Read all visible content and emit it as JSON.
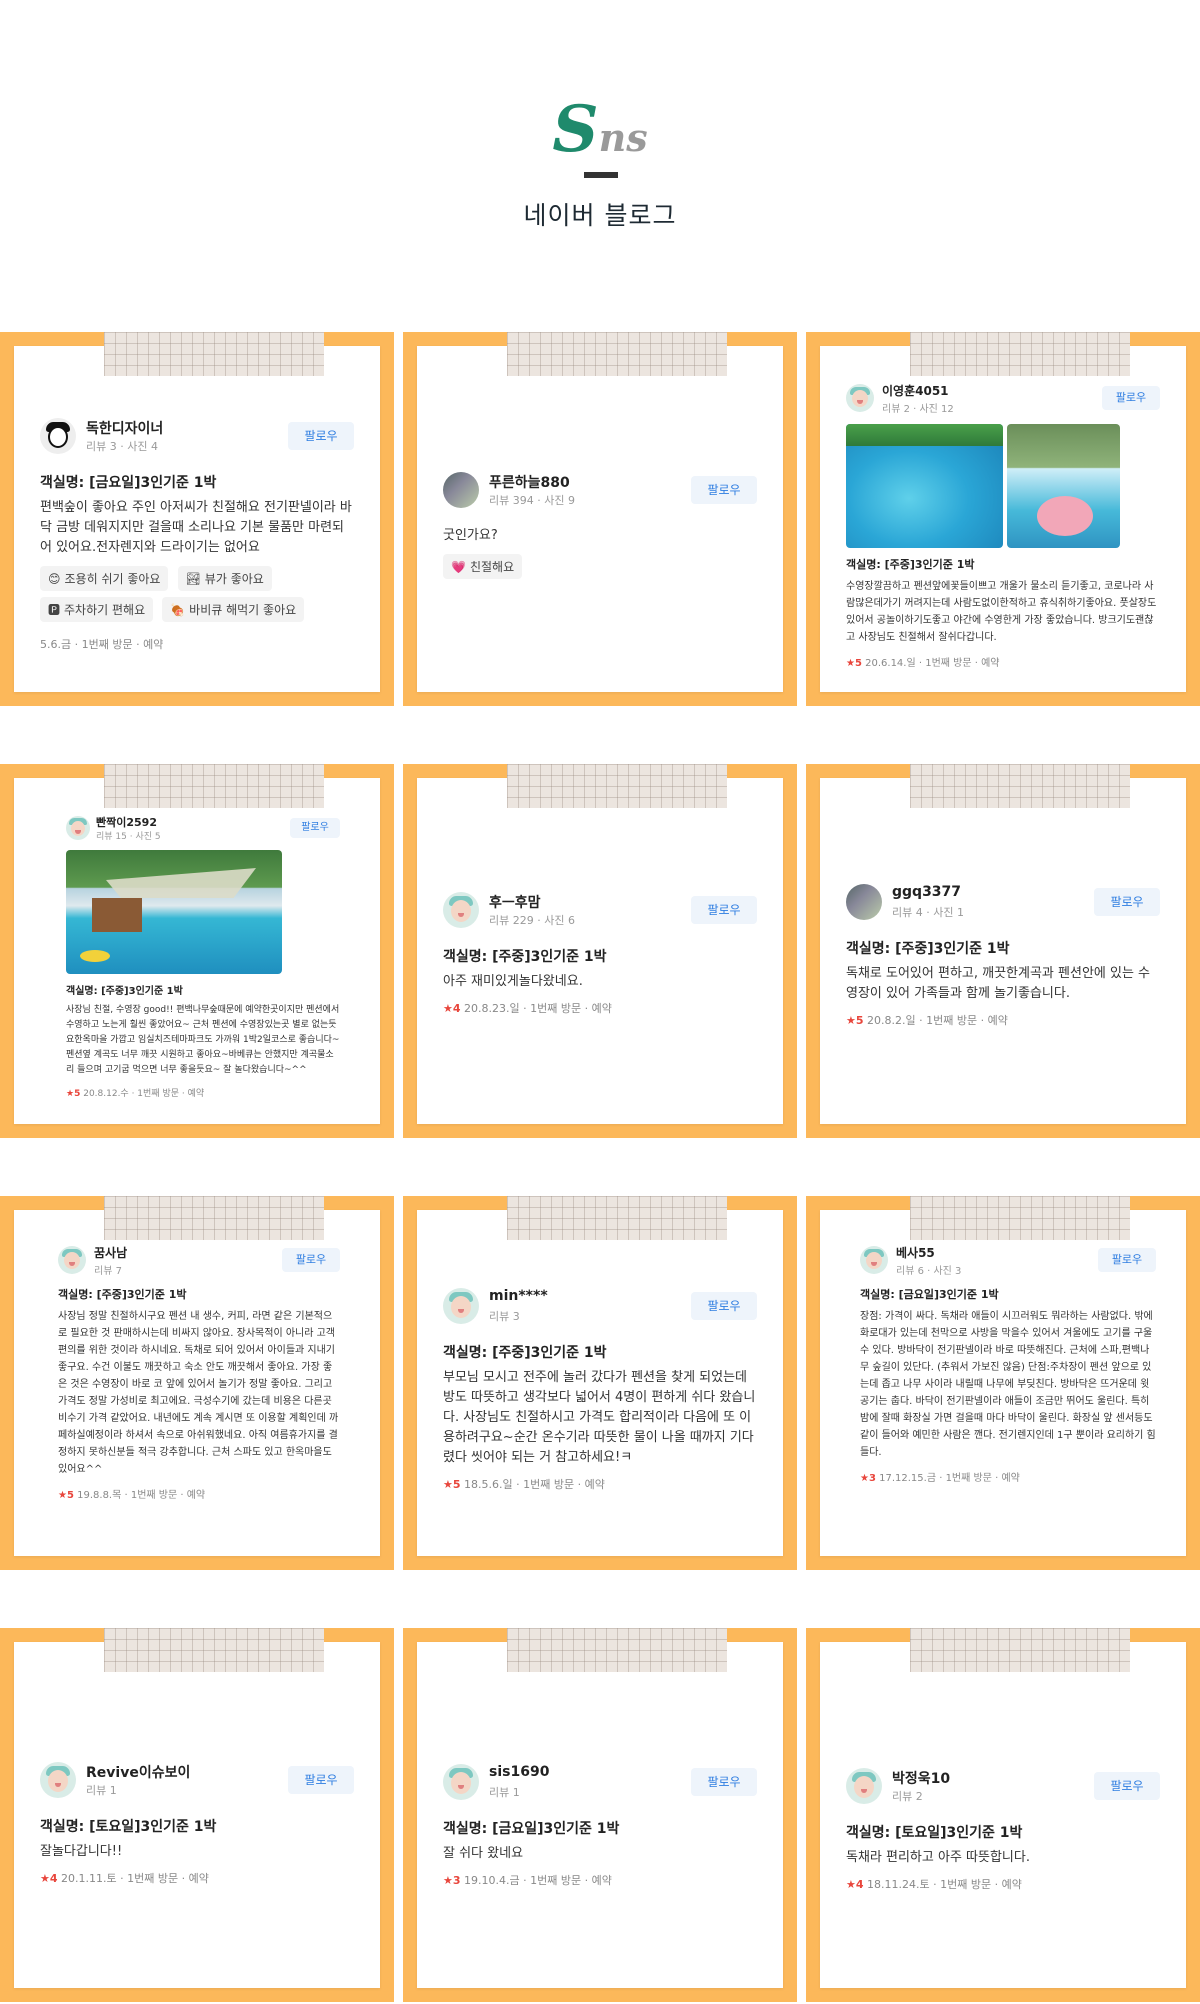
{
  "header": {
    "logo_cap": "S",
    "logo_rest": "ns",
    "title": "네이버 블로그"
  },
  "follow_label": "팔로우",
  "cards": [
    {
      "nick": "독한디자이너",
      "meta": "리뷰 3 · 사진 4",
      "room": "객실명: [금요일]3인기준 1박",
      "body": "편백숲이 좋아요 주인 아저씨가 친절해요 전기판넬이라 바닥 금방 데워지지만 걸을때 소리나요 기본 물품만 마련되어 있어요.전자렌지와 드라이기는 없어요",
      "tags": [
        {
          "icon": "😊",
          "label": "조용히 쉬기 좋아요"
        },
        {
          "icon": "🏞",
          "label": "뷰가 좋아요"
        },
        {
          "icon": "🅿",
          "label": "주차하기 편해요"
        },
        {
          "icon": "🍖",
          "label": "바비큐 해먹기 좋아요"
        }
      ],
      "foot": "5.6.금 · 1번째 방문 · 예약"
    },
    {
      "nick": "푸른하늘880",
      "meta": "리뷰 394 · 사진 9",
      "body": "굿인가요?",
      "tags": [
        {
          "icon": "💗",
          "label": "친절해요"
        }
      ]
    },
    {
      "nick": "이영훈4051",
      "meta": "리뷰 2 · 사진 12",
      "room": "객실명: [주중]3인기준 1박",
      "body": "수영장깔끔하고 펜션앞에꽃들이쁘고 개울가 물소리 듣기좋고, 코로나라 사람많은데가기 꺼려지는데 사람도없이한적하고 휴식취하기좋아요. 풋살장도있어서 공놀이하기도좋고 야간에 수영한게 가장 좋았습니다. 방크기도괜찮고 사장님도 친절해서 잘쉬다갑니다.",
      "star": "★5",
      "foot": "20.6.14.일 · 1번째 방문 · 예약"
    },
    {
      "nick": "빤짝이2592",
      "meta": "리뷰 15 · 사진 5",
      "room": "객실명: [주중]3인기준 1박",
      "body": "사장님 친절, 수영장 good!! 편백나무숲때문에 예약한곳이지만 펜션에서 수영하고 노는게 훨씬 좋았어요~ 근처 펜션에 수영장있는곳 별로 없는듯요한옥마을 가깝고 임실치즈테마파크도 가까워 1박2일코스로 좋습니다~ 펜션옆 계곡도 너무 깨끗 시원하고 좋아요~바베큐는 안했지만 계곡물소리 들으며 고기굽 먹으면 너무 좋을듯요~ 잘 놀다왔습니다~^^",
      "star": "★5",
      "foot": "20.8.12.수 · 1번째 방문 · 예약"
    },
    {
      "nick": "후ㅡ후맘",
      "meta": "리뷰 229 · 사진 6",
      "room": "객실명: [주중]3인기준 1박",
      "body": "아주 재미있게놀다왔네요.",
      "star": "★4",
      "foot": "20.8.23.일 · 1번째 방문 · 예약"
    },
    {
      "nick": "ggq3377",
      "meta": "리뷰 4 · 사진 1",
      "room": "객실명: [주중]3인기준 1박",
      "body": "독채로 도어있어 편하고, 깨끗한계곡과 펜션안에 있는 수영장이 있어 가족들과 함께 놀기좋습니다.",
      "star": "★5",
      "foot": "20.8.2.일 · 1번째 방문 · 예약"
    },
    {
      "nick": "꿈사남",
      "meta": "리뷰 7",
      "room": "객실명: [주중]3인기준 1박",
      "body": "사장님 정말 친절하시구요 펜션 내 생수, 커피, 라면 같은 기본적으로 필요한 것 판매하시는데 비싸지 않아요. 장사목적이 아니라 고객 편의를 위한 것이라 하시네요. 독채로 되어 있어서 아이들과 지내기 좋구요. 수건 이불도 깨끗하고 숙소 안도 깨끗해서 좋아요. 가장 좋은 것은 수영장이 바로 코 앞에 있어서 놀기가 정말 좋아요. 그리고 가격도 정말 가성비로 최고에요. 극성수기에 갔는데 비용은 다른곳 비수기 가격 같았어요. 내년에도 계속 계시면 또 이용할 계획인데 까페하실예정이라 하셔서 속으로 아쉬워했네요. 아직 여름휴가지를 결정하지 못하신분들 적극 강추합니다. 근처 스파도 있고 한옥마을도 있어요^^",
      "star": "★5",
      "foot": "19.8.8.목 · 1번째 방문 · 예약"
    },
    {
      "nick": "min****",
      "meta": "리뷰 3",
      "room": "객실명: [주중]3인기준 1박",
      "body": "부모님 모시고 전주에 놀러 갔다가 펜션을 찾게 되었는데 방도 따뜻하고 생각보다 넓어서 4명이 편하게 쉬다 왔습니다. 사장님도 친절하시고 가격도 합리적이라 다음에 또 이용하려구요~순간 온수기라 따뜻한 물이 나올 때까지 기다렸다 씻어야 되는 거 참고하세요!ㅋ",
      "star": "★5",
      "foot": "18.5.6.일 · 1번째 방문 · 예약"
    },
    {
      "nick": "베사55",
      "meta": "리뷰 6 · 사진 3",
      "room": "객실명: [금요일]3인기준 1박",
      "body": "장점: 가격이 싸다. 독채라 애들이 시끄러워도 뭐라하는 사람없다. 밖에 화로대가 있는데 천막으로 사방을 막을수 있어서 겨울에도 고기를 구울 수 있다. 방바닥이 전기판넬이라 바로 따뜻해진다. 근처에 스파,편백나무 숲길이 있단다. (추워서 가보진 않음) 단점:주차장이 펜션 앞으로 있는데 좁고 나무 사이라 내릴때 나무에 부딪친다. 방바닥은 뜨거운데 윗공기는 춥다. 바닥이 전기판넬이라 애들이 조금만 뛰어도 울린다. 특히 밤에 잘때 화장실 가면 걸을때 마다 바닥이 울린다. 화장실 앞 센서등도 같이 들어와 예민한 사람은 깬다. 전기렌지인데 1구 뿐이라 요리하기 힘들다.",
      "star": "★3",
      "foot": "17.12.15.금 · 1번째 방문 · 예약"
    },
    {
      "nick": "Revive이슈보이",
      "meta": "리뷰 1",
      "room": "객실명: [토요일]3인기준 1박",
      "body": "잘놀다갑니다!!",
      "star": "★4",
      "foot": "20.1.11.토 · 1번째 방문 · 예약"
    },
    {
      "nick": "sis1690",
      "meta": "리뷰 1",
      "room": "객실명: [금요일]3인기준 1박",
      "body": "잘 쉬다 왔네요",
      "star": "★3",
      "foot": "19.10.4.금 · 1번째 방문 · 예약"
    },
    {
      "nick": "박정욱10",
      "meta": "리뷰 2",
      "room": "객실명: [토요일]3인기준 1박",
      "body": "독채라 편리하고 아주 따뜻합니다.",
      "star": "★4",
      "foot": "18.11.24.토 · 1번째 방문 · 예약"
    }
  ],
  "colors": {
    "frame": "#fcb85a",
    "follow_bg": "#eef4fb",
    "follow_text": "#2e7de1",
    "star": "#e8463c",
    "logo": "#1f8a6c"
  }
}
